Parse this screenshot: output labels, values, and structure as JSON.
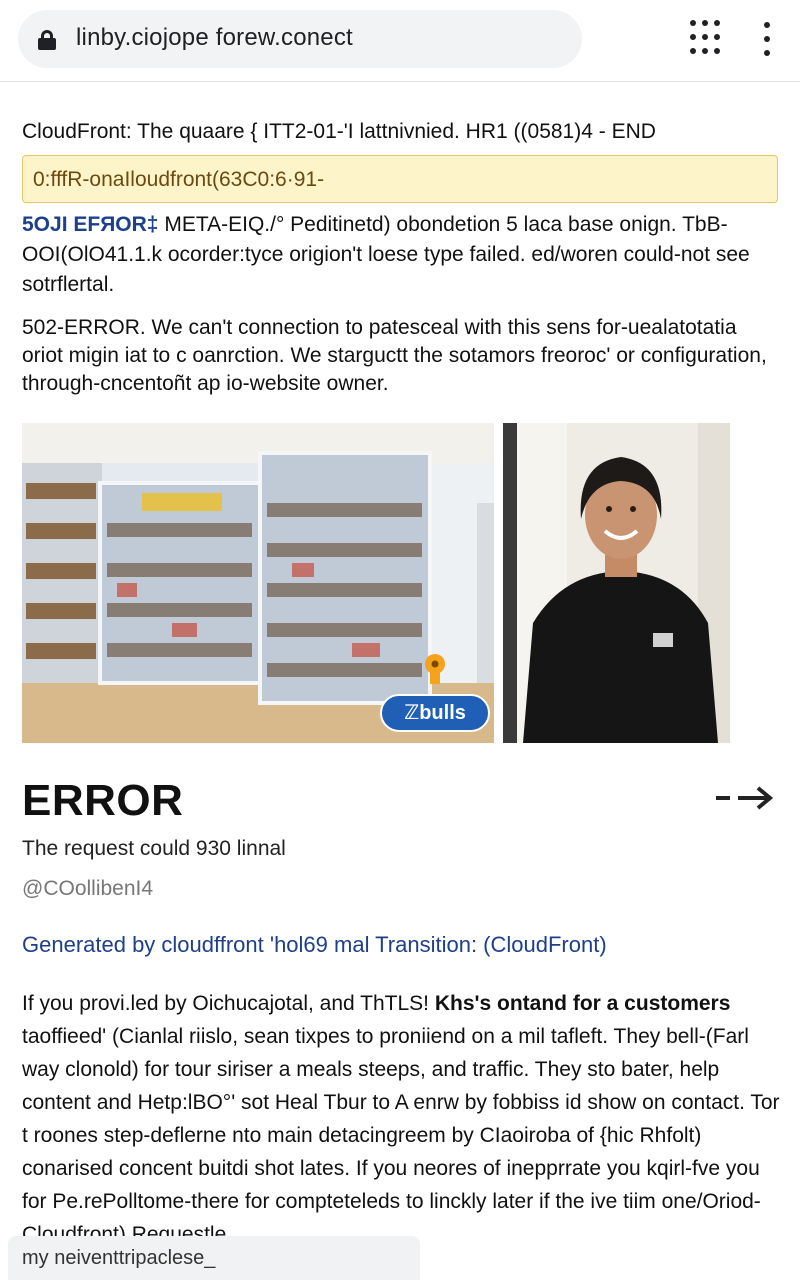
{
  "browser": {
    "url": "linby.ciojope forew.conect",
    "icons": [
      "lock-icon",
      "apps-grid-icon",
      "more-vert-icon"
    ]
  },
  "content": {
    "heading": "CloudFront: The quaare { ITT2-01-'I lattnivnied. HR1 ((0581)4 - END",
    "notice": "0:fffR-onaIloudfront(63C0:6·91-",
    "para1": {
      "error_label": "5OJI EFЯOR‡",
      "text": "META-EIQ./° Peditinetd) obondetion 5 laca base onign. TbB-OOI(OlO41.1.k ocorder:tyce origion't loese type failed. ed/woren could-not see sotrflertal."
    },
    "para2": "502-ERROR. We can't connection to patesceal with this sens for-uealatotatia oriot migin iat to c oanrction. We starguctt the sotamors freoroc' or configuration, through-cncentoñt ap io-website owner.",
    "badge": "ℤbulls",
    "error_title": "ERROR",
    "sub1": "The request could 930 linnal",
    "sub2": "@COollibenI4",
    "generated": "Generated by cloudffront 'hol69 mal Transition: (CloudFront)",
    "para3": {
      "start": "If you provi.led by Oichucajotal, and ThTLS! ",
      "bold": "Khs's ontand for a customers",
      "rest": " taoffieed' (Cianlal riislo, sean tixpes to proniiend on a mil tafleft. They bell-(Farl way clonold)   for tour siriser a meals steeps, and traffic. They sto bater, help content and Hetp:lBO°' sot Heal Tbur to A enrw by fobbiss id show on contact. Tor t roones step-deflerne nto main detacingreem by CIaoiroba of {hic Rhfolt) conarised concent buitdi shot lates. If you neores of inepprrate you kqirl-fve you for Pe.rePolltome-there for compteteleds to linckly later if the ive tiim one/Oriod-Cloudfront) Requestle"
    },
    "bottom_text": "my neiventtripaclese_"
  },
  "colors": {
    "notice_bg": "#fdf5c9",
    "notice_border": "#e4c968",
    "link": "#1d3f8c",
    "badge": "#1f5fb5"
  }
}
